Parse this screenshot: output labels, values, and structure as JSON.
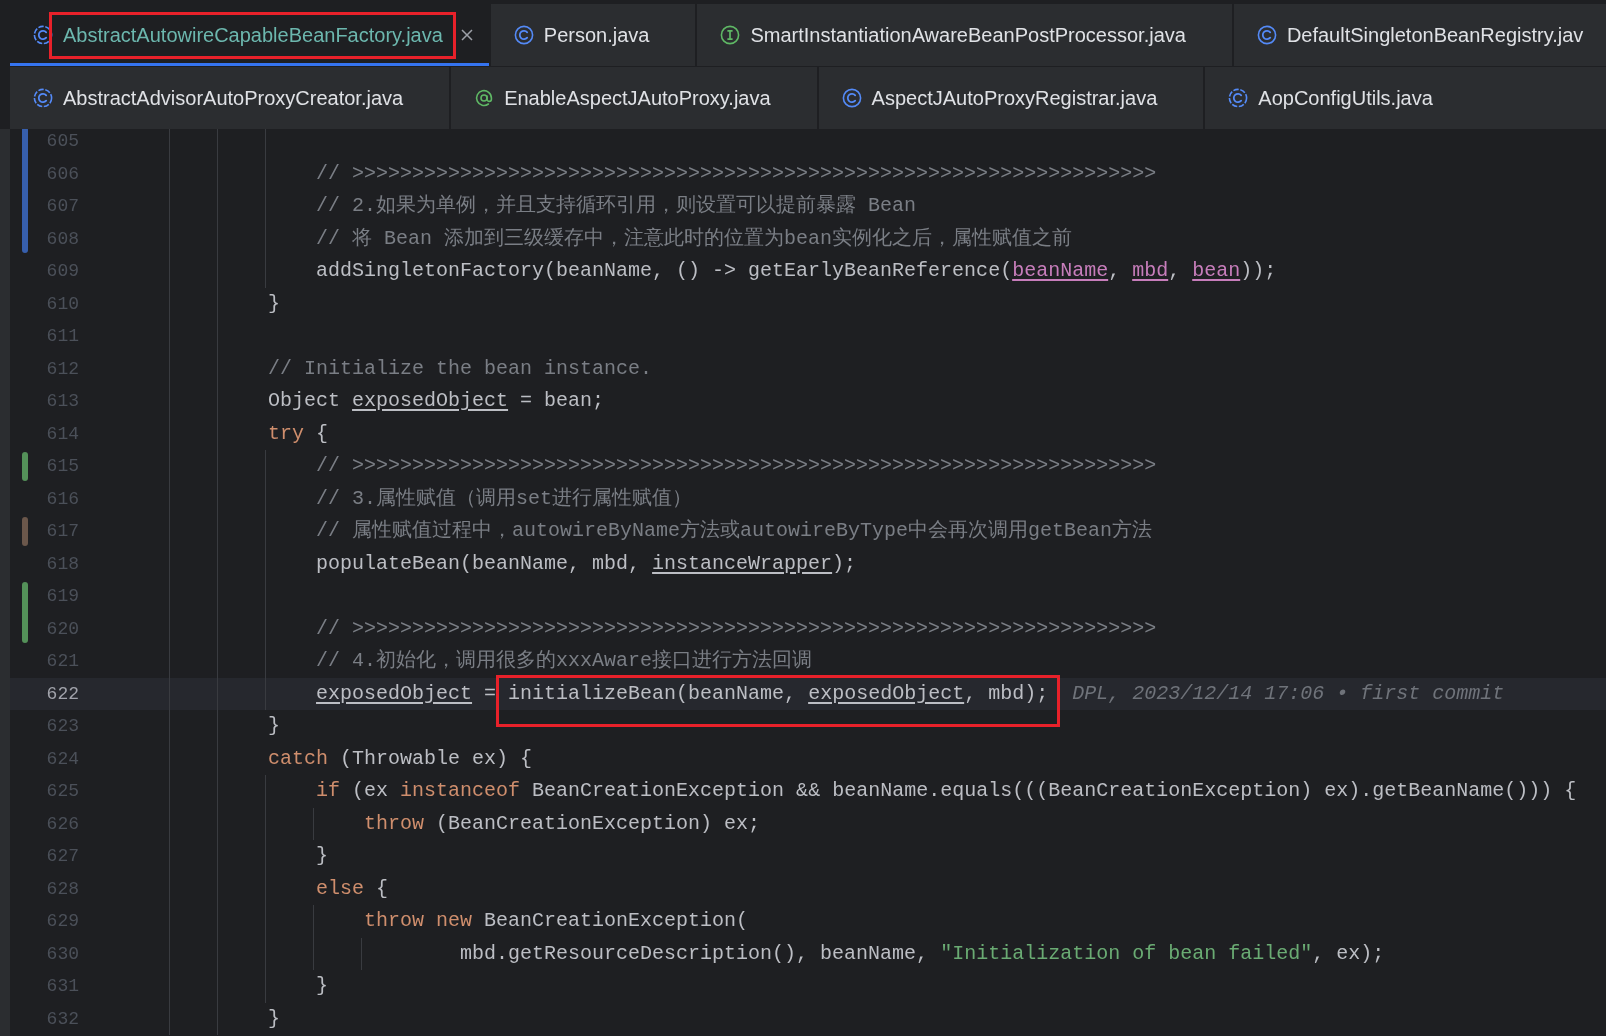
{
  "tab_rows": [
    {
      "tabs": [
        {
          "label": "AbstractAutowireCapableBeanFactory.java",
          "kind": "abstract-class",
          "color": "#6cb7ae",
          "selected": true,
          "annotated": true
        },
        {
          "label": "Person.java",
          "kind": "class",
          "color": "#dfe1e5",
          "selected": false,
          "annotated": false
        },
        {
          "label": "SmartInstantiationAwareBeanPostProcessor.java",
          "kind": "interface",
          "color": "#dfe1e5",
          "selected": false,
          "annotated": false
        },
        {
          "label": "DefaultSingletonBeanRegistry.jav",
          "kind": "class",
          "color": "#dfe1e5",
          "selected": false,
          "annotated": false
        }
      ]
    },
    {
      "tabs": [
        {
          "label": "AbstractAdvisorAutoProxyCreator.java",
          "kind": "abstract-class",
          "color": "#dfe1e5",
          "selected": false,
          "annotated": false
        },
        {
          "label": "EnableAspectJAutoProxy.java",
          "kind": "annotation",
          "color": "#dfe1e5",
          "selected": false,
          "annotated": false
        },
        {
          "label": "AspectJAutoProxyRegistrar.java",
          "kind": "class",
          "color": "#dfe1e5",
          "selected": false,
          "annotated": false
        },
        {
          "label": "AopConfigUtils.java",
          "kind": "abstract-class",
          "color": "#dfe1e5",
          "selected": false,
          "annotated": false
        }
      ]
    }
  ],
  "editor": {
    "lines": [
      {
        "number": "605",
        "current": false,
        "marker": {
          "color": "#375fad"
        }
      },
      {
        "number": "606",
        "current": false,
        "marker": {
          "color": "#375fad"
        },
        "tokens": [
          {
            "kind": "comment",
            "text": "            // >>>>>>>>>>>>>>>>>>>>>>>>>>>>>>>>>>>>>>>>>>>>>>>>>>>>>>>>>>>>>>>>>>>"
          }
        ]
      },
      {
        "number": "607",
        "current": false,
        "marker": {
          "color": "#375fad"
        },
        "tokens": [
          {
            "kind": "comment",
            "text": "            // 2.如果为单例，并且支持循环引用，则设置可以提前暴露 Bean"
          }
        ]
      },
      {
        "number": "608",
        "current": false,
        "marker": {
          "color": "#375fad"
        },
        "tokens": [
          {
            "kind": "comment",
            "text": "            // 将 Bean 添加到三级缓存中，注意此时的位置为bean实例化之后，属性赋值之前"
          }
        ]
      },
      {
        "number": "609",
        "current": false,
        "tokens": [
          {
            "kind": "plain",
            "text": "            addSingletonFactory(beanName, () -> getEarlyBeanReference("
          },
          {
            "kind": "captured",
            "text": "beanName"
          },
          {
            "kind": "plain",
            "text": ", "
          },
          {
            "kind": "captured",
            "text": "mbd"
          },
          {
            "kind": "plain",
            "text": ", "
          },
          {
            "kind": "captured",
            "text": "bean"
          },
          {
            "kind": "plain",
            "text": "));"
          }
        ]
      },
      {
        "number": "610",
        "current": false,
        "tokens": [
          {
            "kind": "plain",
            "text": "        }"
          }
        ]
      },
      {
        "number": "611",
        "current": false
      },
      {
        "number": "612",
        "current": false,
        "tokens": [
          {
            "kind": "comment",
            "text": "        // Initialize the bean instance."
          }
        ]
      },
      {
        "number": "613",
        "current": false,
        "tokens": [
          {
            "kind": "plain",
            "text": "        Object "
          },
          {
            "kind": "reassigned",
            "text": "exposedObject"
          },
          {
            "kind": "plain",
            "text": " = bean;"
          }
        ]
      },
      {
        "number": "614",
        "current": false,
        "tokens": [
          {
            "kind": "keyword",
            "text": "        try"
          },
          {
            "kind": "plain",
            "text": " {"
          }
        ]
      },
      {
        "number": "615",
        "current": false,
        "marker": {
          "color": "#549159"
        },
        "tokens": [
          {
            "kind": "comment",
            "text": "            // >>>>>>>>>>>>>>>>>>>>>>>>>>>>>>>>>>>>>>>>>>>>>>>>>>>>>>>>>>>>>>>>>>>"
          }
        ]
      },
      {
        "number": "616",
        "current": false,
        "tokens": [
          {
            "kind": "comment",
            "text": "            // 3.属性赋值（调用set进行属性赋值）"
          }
        ]
      },
      {
        "number": "617",
        "current": false,
        "marker": {
          "color": "#6b574b"
        },
        "tokens": [
          {
            "kind": "comment",
            "text": "            // 属性赋值过程中，autowireByName方法或autowireByType中会再次调用getBean方法"
          }
        ]
      },
      {
        "number": "618",
        "current": false,
        "tokens": [
          {
            "kind": "plain",
            "text": "            populateBean(beanName, mbd, "
          },
          {
            "kind": "reassigned",
            "text": "instanceWrapper"
          },
          {
            "kind": "plain",
            "text": ");"
          }
        ]
      },
      {
        "number": "619",
        "current": false,
        "marker": {
          "color": "#549159"
        }
      },
      {
        "number": "620",
        "current": false,
        "marker": {
          "color": "#549159"
        },
        "tokens": [
          {
            "kind": "comment",
            "text": "            // >>>>>>>>>>>>>>>>>>>>>>>>>>>>>>>>>>>>>>>>>>>>>>>>>>>>>>>>>>>>>>>>>>>"
          }
        ]
      },
      {
        "number": "621",
        "current": false,
        "tokens": [
          {
            "kind": "comment",
            "text": "            // 4.初始化，调用很多的xxxAware接口进行方法回调"
          }
        ]
      },
      {
        "number": "622",
        "current": true,
        "tokens": [
          {
            "kind": "reassigned",
            "text": "            exposedObject"
          },
          {
            "kind": "plain",
            "text": " = "
          },
          {
            "kind": "annotated",
            "tokens": [
              {
                "kind": "plain",
                "text": "initializeBean(beanName, "
              },
              {
                "kind": "reassigned",
                "text": "exposedObject"
              },
              {
                "kind": "plain",
                "text": ", mbd);"
              }
            ]
          }
        ],
        "blame": "DPL, 2023/12/14 17:06 • first commit"
      },
      {
        "number": "623",
        "current": false,
        "tokens": [
          {
            "kind": "plain",
            "text": "        }"
          }
        ]
      },
      {
        "number": "624",
        "current": false,
        "tokens": [
          {
            "kind": "keyword",
            "text": "        catch"
          },
          {
            "kind": "plain",
            "text": " (Throwable ex) {"
          }
        ]
      },
      {
        "number": "625",
        "current": false,
        "tokens": [
          {
            "kind": "keyword",
            "text": "            if"
          },
          {
            "kind": "plain",
            "text": " (ex "
          },
          {
            "kind": "keyword",
            "text": "instanceof"
          },
          {
            "kind": "plain",
            "text": " BeanCreationException && beanName.equals(((BeanCreationException) ex).getBeanName())) {"
          }
        ]
      },
      {
        "number": "626",
        "current": false,
        "tokens": [
          {
            "kind": "keyword",
            "text": "                throw"
          },
          {
            "kind": "plain",
            "text": " (BeanCreationException) ex;"
          }
        ]
      },
      {
        "number": "627",
        "current": false,
        "tokens": [
          {
            "kind": "plain",
            "text": "            }"
          }
        ]
      },
      {
        "number": "628",
        "current": false,
        "tokens": [
          {
            "kind": "keyword",
            "text": "            else"
          },
          {
            "kind": "plain",
            "text": " {"
          }
        ]
      },
      {
        "number": "629",
        "current": false,
        "tokens": [
          {
            "kind": "keyword",
            "text": "                throw new"
          },
          {
            "kind": "plain",
            "text": " BeanCreationException("
          }
        ]
      },
      {
        "number": "630",
        "current": false,
        "tokens": [
          {
            "kind": "plain",
            "text": "                        mbd.getResourceDescription(), beanName, "
          },
          {
            "kind": "string",
            "text": "\"Initialization of bean failed\""
          },
          {
            "kind": "plain",
            "text": ", ex);"
          }
        ]
      },
      {
        "number": "631",
        "current": false,
        "tokens": [
          {
            "kind": "plain",
            "text": "            }"
          }
        ]
      },
      {
        "number": "632",
        "current": false,
        "tokens": [
          {
            "kind": "plain",
            "text": "        }"
          }
        ]
      }
    ]
  }
}
